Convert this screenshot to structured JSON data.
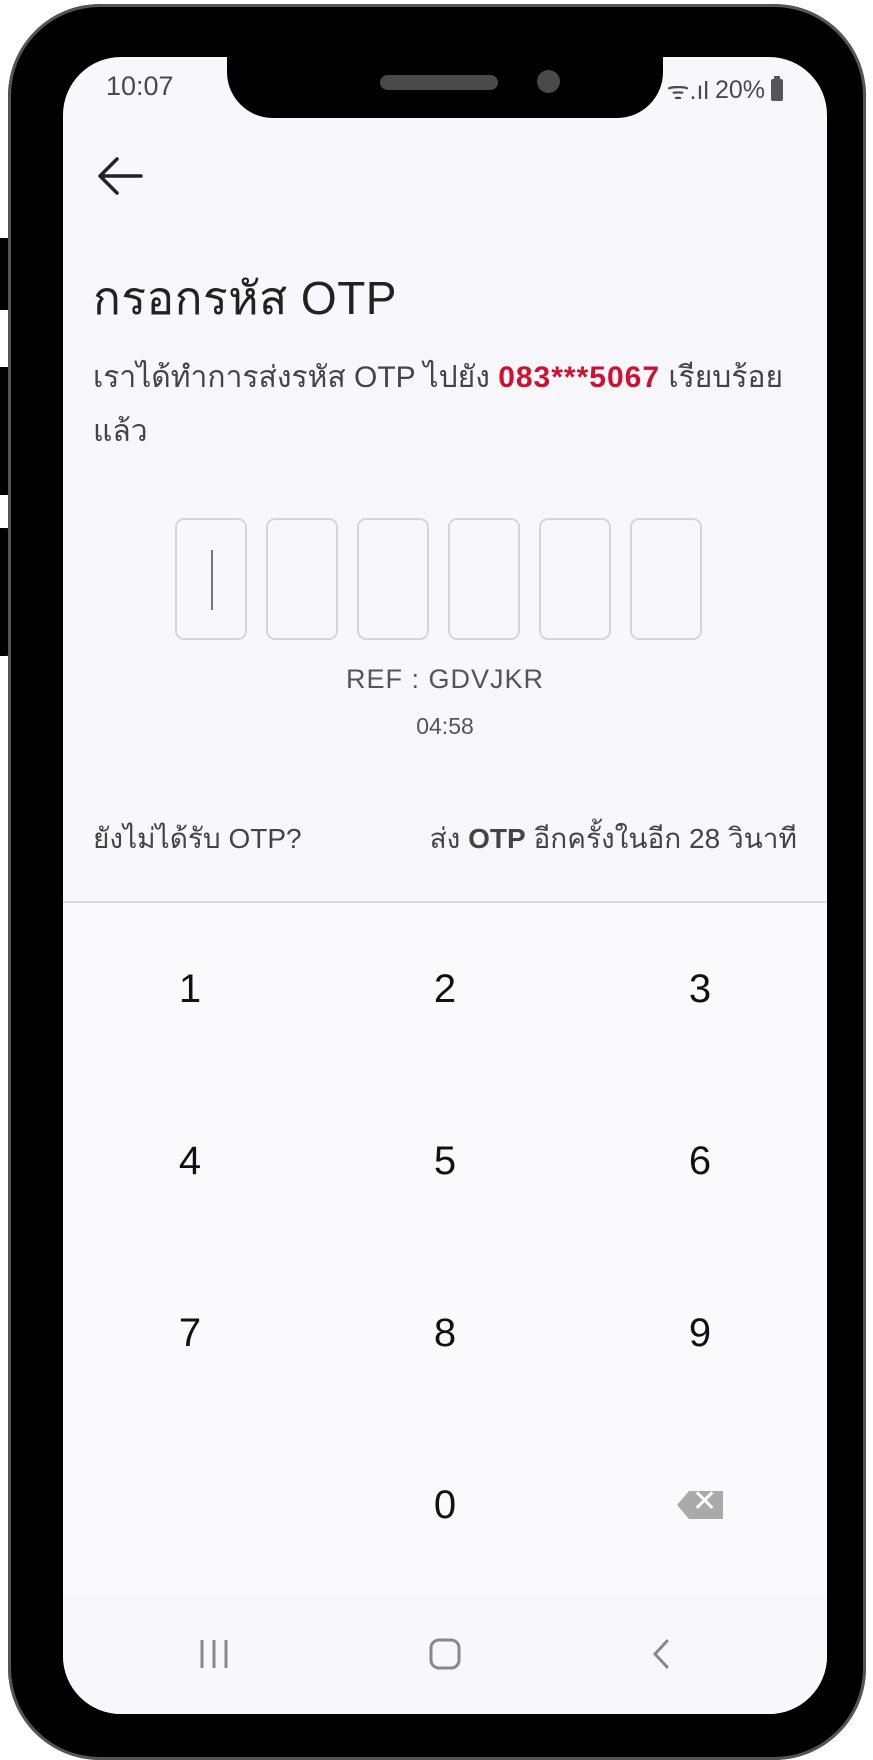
{
  "status_bar": {
    "time": "10:07",
    "signal": "ᯤ.ıl",
    "battery": "20%"
  },
  "header": {
    "back_icon": "arrow-left-icon",
    "title": "กรอกรหัส OTP"
  },
  "message": {
    "prefix": "เราได้ทำการส่งรหัส OTP ไปยัง ",
    "phone": "083***5067",
    "suffix": " เรียบร้อยแล้ว"
  },
  "otp": {
    "ref": "REF : GDVJKR",
    "countdown": "04:58"
  },
  "resend": {
    "question": "ยังไม่ได้รับ OTP?",
    "prefix": "ส่ง ",
    "otp_word": "OTP",
    "suffix": " อีกครั้งในอีก 28 วินาที"
  },
  "keypad": {
    "keys": [
      "1",
      "2",
      "3",
      "4",
      "5",
      "6",
      "7",
      "8",
      "9",
      "0"
    ],
    "delete_icon": "backspace-icon"
  },
  "nav": {
    "recents_icon": "recents-icon",
    "home_icon": "home-icon",
    "back_icon": "back-chevron-icon"
  },
  "colors": {
    "accent": "#d0102f",
    "background": "#f8f7fc"
  }
}
